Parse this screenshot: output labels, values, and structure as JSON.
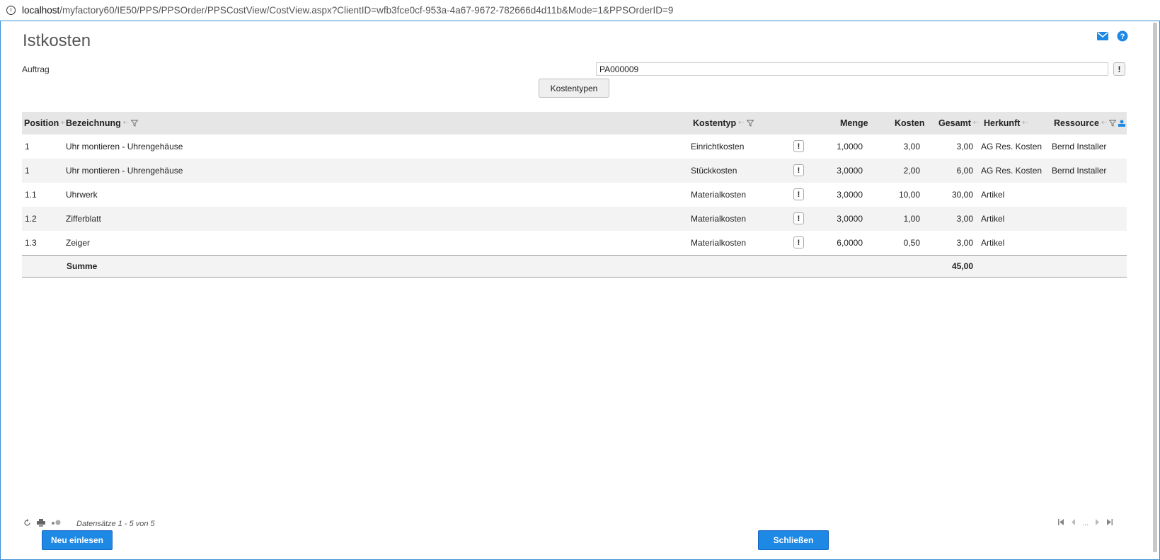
{
  "browser": {
    "url_host": "localhost",
    "url_path": "/myfactory60/IE50/PPS/PPSOrder/PPSCostView/CostView.aspx?ClientID=wfb3fce0cf-953a-4a67-9672-782666d4d11b&Mode=1&PPSOrderID=9"
  },
  "page": {
    "title": "Istkosten",
    "auftrag_label": "Auftrag",
    "auftrag_value": "PA000009",
    "info_button": "!",
    "kostentypen_button": "Kostentypen"
  },
  "grid": {
    "headers": {
      "position": "Position",
      "bezeichnung": "Bezeichnung",
      "kostentyp": "Kostentyp",
      "menge": "Menge",
      "kosten": "Kosten",
      "gesamt": "Gesamt",
      "herkunft": "Herkunft",
      "ressource": "Ressource"
    },
    "rows": [
      {
        "position": "1",
        "bezeichnung": "Uhr montieren - Uhrengehäuse",
        "kostentyp": "Einrichtkosten",
        "menge": "1,0000",
        "kosten": "3,00",
        "gesamt": "3,00",
        "herkunft": "AG Res. Kosten",
        "ressource": "Bernd Installer"
      },
      {
        "position": "1",
        "bezeichnung": "Uhr montieren - Uhrengehäuse",
        "kostentyp": "Stückkosten",
        "menge": "3,0000",
        "kosten": "2,00",
        "gesamt": "6,00",
        "herkunft": "AG Res. Kosten",
        "ressource": "Bernd Installer"
      },
      {
        "position": "1.1",
        "bezeichnung": "Uhrwerk",
        "kostentyp": "Materialkosten",
        "menge": "3,0000",
        "kosten": "10,00",
        "gesamt": "30,00",
        "herkunft": "Artikel",
        "ressource": ""
      },
      {
        "position": "1.2",
        "bezeichnung": "Zifferblatt",
        "kostentyp": "Materialkosten",
        "menge": "3,0000",
        "kosten": "1,00",
        "gesamt": "3,00",
        "herkunft": "Artikel",
        "ressource": ""
      },
      {
        "position": "1.3",
        "bezeichnung": "Zeiger",
        "kostentyp": "Materialkosten",
        "menge": "6,0000",
        "kosten": "0,50",
        "gesamt": "3,00",
        "herkunft": "Artikel",
        "ressource": ""
      }
    ],
    "row_button": "!",
    "sum_label": "Summe",
    "sum_value": "45,00"
  },
  "pager": {
    "records": "Datensätze 1 - 5 von 5",
    "ellipsis": "..."
  },
  "buttons": {
    "neu_einlesen": "Neu einlesen",
    "schliessen": "Schließen"
  },
  "colors": {
    "accent": "#1e88e5",
    "header_bg": "#e6e6e6",
    "alt_row_bg": "#f3f3f3"
  }
}
